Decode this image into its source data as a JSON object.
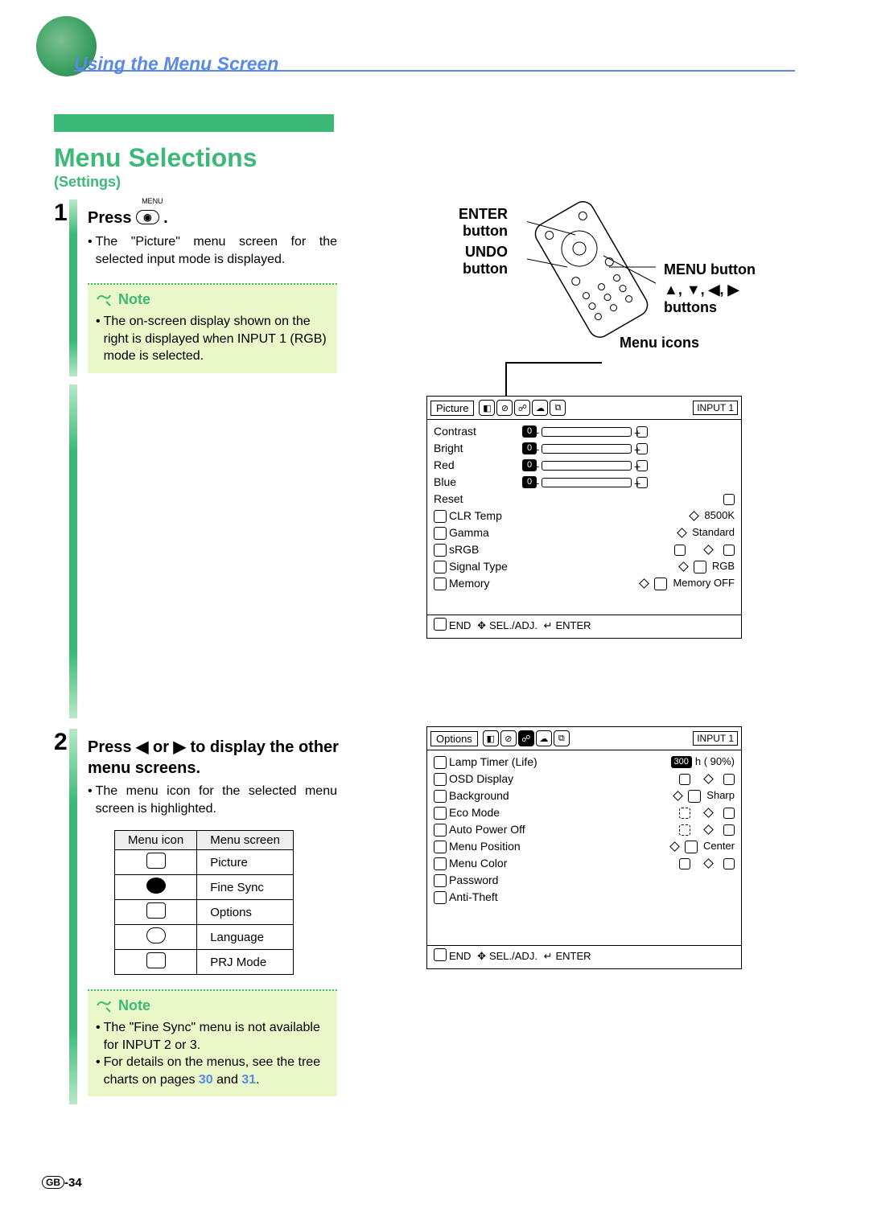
{
  "header": {
    "title": "Using the Menu Screen"
  },
  "section": {
    "title": "Menu Selections",
    "subtitle": "(Settings)"
  },
  "step1": {
    "number": "1",
    "heading_prefix": "Press",
    "menu_small": "MENU",
    "bullet": "The \"Picture\" menu screen for the selected input mode is displayed.",
    "note_label": "Note",
    "note_bullet": "The on-screen display shown on the right is displayed when INPUT 1 (RGB) mode is selected."
  },
  "remote": {
    "enter": "ENTER button",
    "undo": "UNDO button",
    "menu": "MENU button",
    "arrows": "▲, ▼, ◀, ▶ buttons",
    "menu_icons": "Menu icons"
  },
  "osd1": {
    "tab": "Picture",
    "input": "INPUT 1",
    "rows_numeric": [
      "Contrast",
      "Bright",
      "Red",
      "Blue"
    ],
    "reset": "Reset",
    "items": [
      {
        "label": "CLR Temp",
        "value": "8500K"
      },
      {
        "label": "Gamma",
        "value": "Standard"
      },
      {
        "label": "sRGB",
        "value": ""
      },
      {
        "label": "Signal Type",
        "value": "RGB"
      },
      {
        "label": "Memory",
        "value": "Memory OFF"
      }
    ],
    "footer": "END   SEL./ADJ.   ENTER"
  },
  "step2": {
    "number": "2",
    "heading": "Press ◀ or ▶ to display the other menu screens.",
    "bullet": "The menu icon for the selected menu screen is highlighted.",
    "table": {
      "head": [
        "Menu icon",
        "Menu screen"
      ],
      "rows": [
        "Picture",
        "Fine Sync",
        "Options",
        "Language",
        "PRJ Mode"
      ]
    },
    "note_label": "Note",
    "note_bullets": [
      "The \"Fine Sync\" menu is not available for INPUT 2 or 3.",
      "For details on the menus, see the tree charts on pages "
    ],
    "page_link_1": "30",
    "and": " and ",
    "page_link_2": "31",
    "period": "."
  },
  "osd2": {
    "tab": "Options",
    "input": "INPUT 1",
    "items": [
      {
        "label": "Lamp Timer  (Life)",
        "value": "300 h (   90%)"
      },
      {
        "label": "OSD Display",
        "value": ""
      },
      {
        "label": "Background",
        "value": "Sharp"
      },
      {
        "label": "Eco Mode",
        "value": ""
      },
      {
        "label": "Auto Power Off",
        "value": ""
      },
      {
        "label": "Menu Position",
        "value": "Center"
      },
      {
        "label": "Menu Color",
        "value": ""
      },
      {
        "label": "Password",
        "value": ""
      },
      {
        "label": "Anti-Theft",
        "value": ""
      }
    ],
    "footer": "END   SEL./ADJ.   ENTER"
  },
  "footer": {
    "page": "-34",
    "gb": "GB"
  }
}
